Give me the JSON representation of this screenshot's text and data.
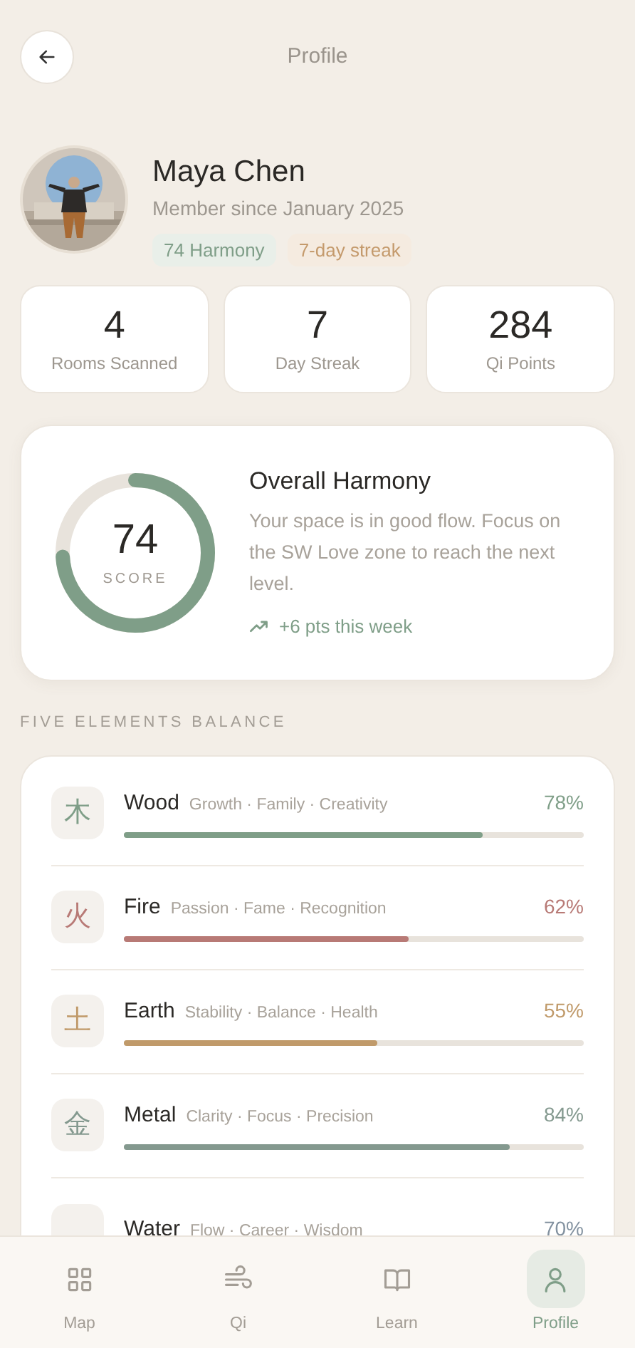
{
  "header": {
    "title": "Profile"
  },
  "profile": {
    "name": "Maya Chen",
    "member_since": "Member since January 2025",
    "badges": [
      {
        "text": "74 Harmony",
        "kind": "harmony"
      },
      {
        "text": "7-day streak",
        "kind": "streak"
      }
    ]
  },
  "stats": [
    {
      "value": "4",
      "label": "Rooms Scanned"
    },
    {
      "value": "7",
      "label": "Day Streak"
    },
    {
      "value": "284",
      "label": "Qi Points"
    }
  ],
  "harmony": {
    "score": "74",
    "score_label": "SCORE",
    "title": "Overall Harmony",
    "description": "Your space is in good flow. Focus on the SW Love zone to reach the next level.",
    "trend": "+6 pts this week"
  },
  "elements_section": {
    "title": "FIVE ELEMENTS BALANCE",
    "elements": [
      {
        "glyph": "木",
        "name": "Wood",
        "traits": "Growth · Family · Creativity",
        "percent": "78%",
        "level": 0.78,
        "color": "#7f9e88"
      },
      {
        "glyph": "火",
        "name": "Fire",
        "traits": "Passion · Fame · Recognition",
        "percent": "62%",
        "level": 0.62,
        "color": "#b87a76"
      },
      {
        "glyph": "土",
        "name": "Earth",
        "traits": "Stability · Balance · Health",
        "percent": "55%",
        "level": 0.55,
        "color": "#c09a6a"
      },
      {
        "glyph": "金",
        "name": "Metal",
        "traits": "Clarity · Focus · Precision",
        "percent": "84%",
        "level": 0.84,
        "color": "#84998f"
      },
      {
        "name": "Water",
        "traits": "Flow · Career · Wisdom",
        "percent": "70%",
        "color": "#8392a0"
      }
    ]
  },
  "nav": [
    {
      "label": "Map",
      "selected": false
    },
    {
      "label": "Qi",
      "selected": false
    },
    {
      "label": "Learn",
      "selected": false
    },
    {
      "label": "Profile",
      "selected": true
    }
  ]
}
